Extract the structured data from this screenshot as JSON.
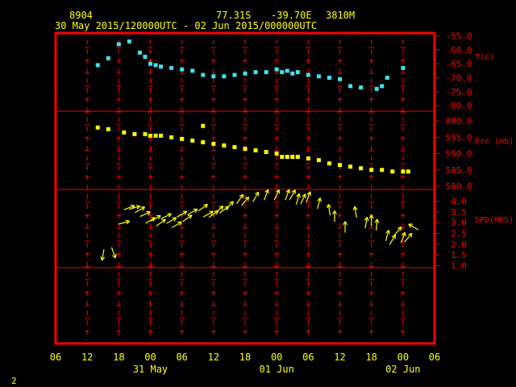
{
  "header": {
    "station": "8904",
    "lat": "77.31S",
    "lon": "-39.70E",
    "elev": "3810M",
    "period": "30 May 2015/120000UTC - 02 Jun 2015/000000UTC"
  },
  "footer": {
    "page_number": "2"
  },
  "colors": {
    "frame": "#ff0000",
    "axis_text": "#ffff00",
    "panel_labels": "#ff0000",
    "temperature": "#40e0f0",
    "pressure": "#ffff00",
    "wind": "#ffff00"
  },
  "chart_data": {
    "type": "scatter",
    "x_axis": {
      "ticks": [
        "06",
        "12",
        "18",
        "00",
        "06",
        "12",
        "18",
        "00",
        "06",
        "12",
        "18",
        "00",
        "06"
      ],
      "tick_hours": [
        -6,
        0,
        6,
        12,
        18,
        24,
        30,
        36,
        42,
        48,
        54,
        60,
        66
      ],
      "date_labels": [
        {
          "label": "31 May",
          "hour": 12
        },
        {
          "label": "01 Jun",
          "hour": 36
        },
        {
          "label": "02 Jun",
          "hour": 60
        }
      ],
      "range_hours": [
        -6,
        66
      ]
    },
    "panels": [
      {
        "id": "temperature",
        "label": "T(C)",
        "ticks": [
          "-55.0",
          "-60.0",
          "-65.0",
          "-70.0",
          "-75.0",
          "-80.0"
        ],
        "tick_values": [
          -55,
          -60,
          -65,
          -70,
          -75,
          -80
        ],
        "range": [
          -82,
          -54
        ],
        "points": [
          [
            2,
            -65.5
          ],
          [
            4,
            -63
          ],
          [
            6,
            -58
          ],
          [
            8,
            -57
          ],
          [
            10,
            -61
          ],
          [
            11,
            -62.5
          ],
          [
            12,
            -65
          ],
          [
            13,
            -65.5
          ],
          [
            14,
            -66
          ],
          [
            16,
            -66.5
          ],
          [
            18,
            -67
          ],
          [
            20,
            -67.5
          ],
          [
            22,
            -69
          ],
          [
            24,
            -69.5
          ],
          [
            26,
            -69.5
          ],
          [
            28,
            -69
          ],
          [
            30,
            -68.5
          ],
          [
            32,
            -68
          ],
          [
            34,
            -68
          ],
          [
            36,
            -67
          ],
          [
            37,
            -68
          ],
          [
            38,
            -67.5
          ],
          [
            39,
            -68.5
          ],
          [
            40,
            -68
          ],
          [
            42,
            -69
          ],
          [
            44,
            -69.5
          ],
          [
            46,
            -70
          ],
          [
            48,
            -70.5
          ],
          [
            50,
            -73
          ],
          [
            52,
            -73.5
          ],
          [
            55,
            -74
          ],
          [
            56,
            -73
          ],
          [
            57,
            -70
          ],
          [
            60,
            -66.5
          ]
        ]
      },
      {
        "id": "pressure",
        "label": "Pre (mb)",
        "ticks": [
          "800.0",
          "595.0",
          "590.0",
          "585.0",
          "580.0"
        ],
        "tick_values": [
          600,
          595,
          590,
          585,
          580
        ],
        "range": [
          579,
          603
        ],
        "points": [
          [
            2,
            598
          ],
          [
            4,
            597.5
          ],
          [
            7,
            596.5
          ],
          [
            9,
            596
          ],
          [
            11,
            596
          ],
          [
            12,
            595.5
          ],
          [
            13,
            595.5
          ],
          [
            14,
            595.5
          ],
          [
            16,
            595
          ],
          [
            18,
            594.5
          ],
          [
            20,
            594
          ],
          [
            22,
            593.5
          ],
          [
            24,
            593
          ],
          [
            26,
            592.5
          ],
          [
            28,
            592
          ],
          [
            30,
            591.5
          ],
          [
            32,
            591
          ],
          [
            34,
            590.5
          ],
          [
            36,
            590
          ],
          [
            37,
            589
          ],
          [
            38,
            589
          ],
          [
            39,
            589
          ],
          [
            40,
            589
          ],
          [
            42,
            588.5
          ],
          [
            44,
            588
          ],
          [
            46,
            587
          ],
          [
            48,
            586.5
          ],
          [
            50,
            586
          ],
          [
            52,
            585.5
          ],
          [
            54,
            585
          ],
          [
            56,
            585
          ],
          [
            58,
            584.5
          ],
          [
            60,
            584.5
          ],
          [
            61,
            584.5
          ],
          [
            22,
            598.5
          ]
        ]
      },
      {
        "id": "wind",
        "label": "SPD(MPS)",
        "ticks": [
          "4.0",
          "3.5",
          "3.0",
          "2.5",
          "2.0",
          "1.5",
          "1.0"
        ],
        "tick_values": [
          4,
          3.5,
          3,
          2.5,
          2,
          1.5,
          1
        ],
        "range": [
          0.9,
          4.55
        ],
        "arrows": [
          {
            "t": 3,
            "spd": 1.5,
            "dir": 190
          },
          {
            "t": 5,
            "spd": 1.6,
            "dir": 160
          },
          {
            "t": 7,
            "spd": 3.0,
            "dir": 75
          },
          {
            "t": 8,
            "spd": 3.7,
            "dir": 70
          },
          {
            "t": 9,
            "spd": 3.7,
            "dir": 75
          },
          {
            "t": 10,
            "spd": 3.6,
            "dir": 60
          },
          {
            "t": 11,
            "spd": 3.4,
            "dir": 65
          },
          {
            "t": 12,
            "spd": 3.1,
            "dir": 60
          },
          {
            "t": 13,
            "spd": 3.2,
            "dir": 60
          },
          {
            "t": 14,
            "spd": 3.0,
            "dir": 55
          },
          {
            "t": 15,
            "spd": 3.3,
            "dir": 65
          },
          {
            "t": 16,
            "spd": 3.1,
            "dir": 60
          },
          {
            "t": 17,
            "spd": 2.9,
            "dir": 60
          },
          {
            "t": 18,
            "spd": 3.4,
            "dir": 60
          },
          {
            "t": 19,
            "spd": 3.2,
            "dir": 55
          },
          {
            "t": 20,
            "spd": 3.5,
            "dir": 60
          },
          {
            "t": 22,
            "spd": 3.7,
            "dir": 55
          },
          {
            "t": 23,
            "spd": 3.4,
            "dir": 60
          },
          {
            "t": 24,
            "spd": 3.4,
            "dir": 55
          },
          {
            "t": 25,
            "spd": 3.6,
            "dir": 50
          },
          {
            "t": 26,
            "spd": 3.6,
            "dir": 55
          },
          {
            "t": 27,
            "spd": 3.8,
            "dir": 45
          },
          {
            "t": 29,
            "spd": 4.1,
            "dir": 35
          },
          {
            "t": 30,
            "spd": 4.0,
            "dir": 40
          },
          {
            "t": 32,
            "spd": 4.2,
            "dir": 30
          },
          {
            "t": 34,
            "spd": 4.3,
            "dir": 20
          },
          {
            "t": 36,
            "spd": 4.3,
            "dir": 25
          },
          {
            "t": 38,
            "spd": 4.3,
            "dir": 20
          },
          {
            "t": 39,
            "spd": 4.3,
            "dir": 30
          },
          {
            "t": 40,
            "spd": 4.1,
            "dir": 15
          },
          {
            "t": 41,
            "spd": 4.1,
            "dir": 25
          },
          {
            "t": 42,
            "spd": 4.2,
            "dir": 20
          },
          {
            "t": 44,
            "spd": 3.9,
            "dir": 15
          },
          {
            "t": 46,
            "spd": 3.6,
            "dir": 350
          },
          {
            "t": 47,
            "spd": 3.3,
            "dir": 0
          },
          {
            "t": 49,
            "spd": 2.8,
            "dir": 0
          },
          {
            "t": 51,
            "spd": 3.5,
            "dir": 350
          },
          {
            "t": 53,
            "spd": 3.0,
            "dir": 10
          },
          {
            "t": 54,
            "spd": 3.1,
            "dir": 0
          },
          {
            "t": 55,
            "spd": 2.9,
            "dir": 5
          },
          {
            "t": 57,
            "spd": 2.4,
            "dir": 15
          },
          {
            "t": 58,
            "spd": 2.2,
            "dir": 30
          },
          {
            "t": 59,
            "spd": 2.6,
            "dir": 40
          },
          {
            "t": 60,
            "spd": 2.3,
            "dir": 20
          },
          {
            "t": 61,
            "spd": 2.3,
            "dir": 40
          },
          {
            "t": 62,
            "spd": 2.8,
            "dir": 300
          }
        ]
      }
    ]
  }
}
